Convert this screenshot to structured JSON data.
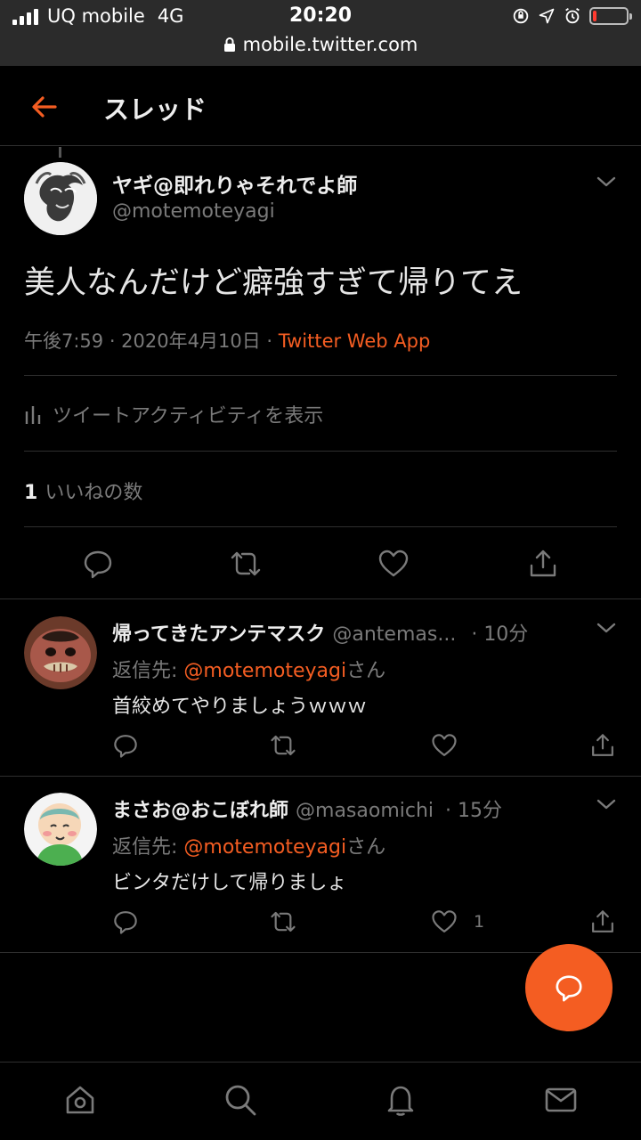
{
  "status_bar": {
    "carrier": "UQ mobile",
    "network": "4G",
    "time": "20:20",
    "url": "mobile.twitter.com",
    "battery_level": 0.12,
    "battery_color": "#ff3b30"
  },
  "header": {
    "title": "スレッド",
    "back_icon": "arrow-left-icon"
  },
  "colors": {
    "accent": "#f45d22",
    "background": "#000000",
    "muted": "#7a7a7a"
  },
  "main_tweet": {
    "display_name": "ヤギ@即れりゃそれでよ師",
    "handle": "@motemoteyagi",
    "text": "美人なんだけど癖強すぎて帰りてえ",
    "timestamp": "午後7:59 · 2020年4月10日 · ",
    "source": "Twitter Web App",
    "activity_label": "ツイートアクティビティを表示",
    "likes_count": "1",
    "likes_label": "いいねの数"
  },
  "replies": [
    {
      "display_name": "帰ってきたアンテマスク",
      "handle": "@antemas...",
      "time": "· 10分",
      "reply_prefix": "返信先: ",
      "reply_to": "@motemoteyagi",
      "reply_suffix": "さん",
      "text": "首絞めてやりましょうｗｗｗ",
      "like_count": ""
    },
    {
      "display_name": "まさお@おこぼれ師",
      "handle": "@masaomichi",
      "time": "· 15分",
      "reply_prefix": "返信先: ",
      "reply_to": "@motemoteyagi",
      "reply_suffix": "さん",
      "text": "ビンタだけして帰りましょ",
      "like_count": "1"
    }
  ],
  "bottom_nav": [
    "home-icon",
    "search-icon",
    "notifications-icon",
    "messages-icon"
  ]
}
